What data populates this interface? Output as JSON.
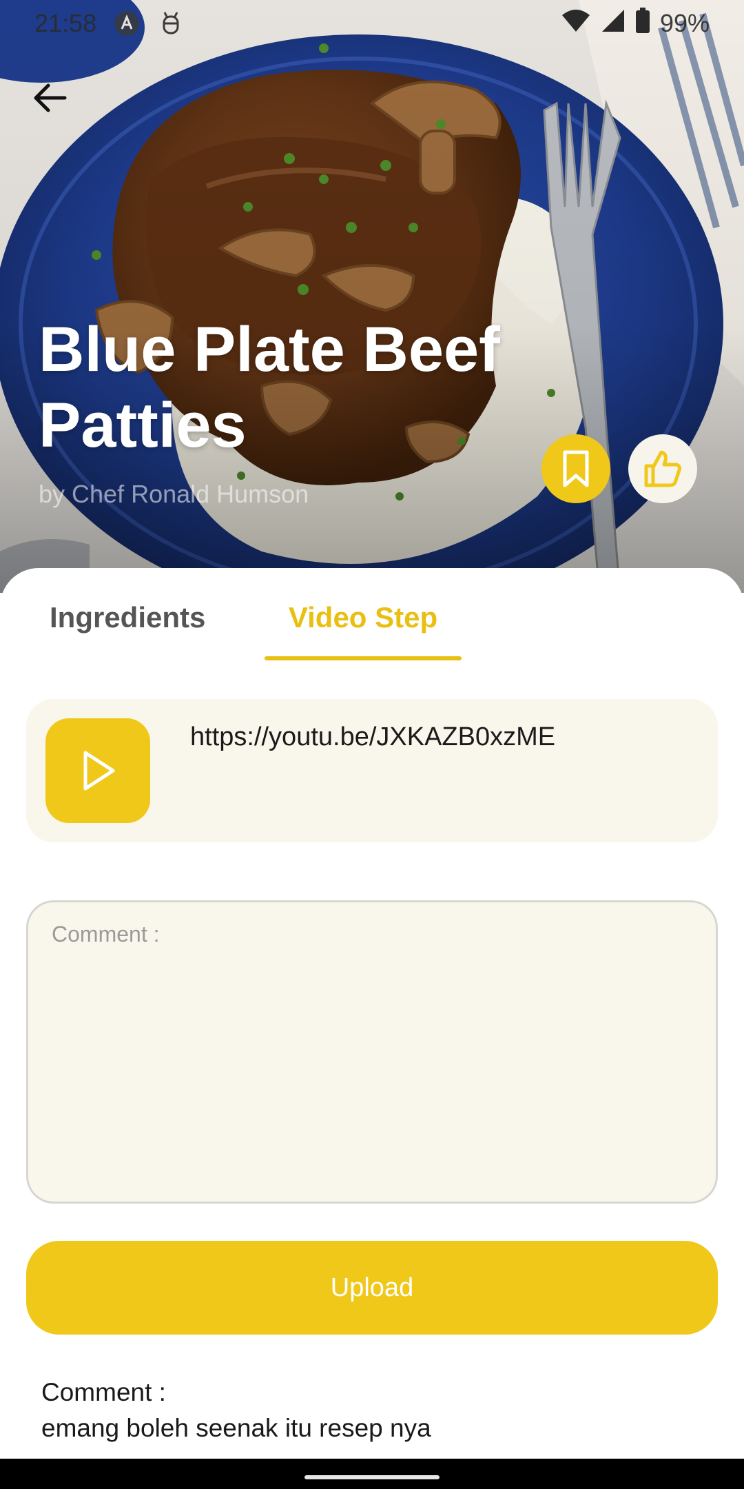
{
  "status_bar": {
    "time": "21:58",
    "battery_percent": "99%",
    "icons": [
      "app-a-icon",
      "bug-icon",
      "wifi-icon",
      "signal-icon",
      "battery-icon"
    ]
  },
  "navigation": {
    "back_icon": "arrow-left-icon"
  },
  "recipe": {
    "title": "Blue Plate Beef Patties",
    "author": "by Chef Ronald Humson",
    "actions": [
      {
        "name": "bookmark",
        "icon": "bookmark-icon",
        "color": "#f0c81a"
      },
      {
        "name": "like",
        "icon": "thumbs-up-icon",
        "color": "#f7f4ec"
      }
    ]
  },
  "tabs": [
    {
      "label": "Ingredients",
      "active": false
    },
    {
      "label": "Video Step",
      "active": true
    }
  ],
  "video": {
    "play_icon": "play-icon",
    "url": "https://youtu.be/JXKAZB0xzME"
  },
  "comment_form": {
    "placeholder": "Comment :",
    "value": "",
    "upload_label": "Upload"
  },
  "comments": {
    "label": "Comment :",
    "items": [
      {
        "text": "emang boleh seenak itu resep nya"
      }
    ]
  },
  "colors": {
    "accent": "#f0c81a",
    "active_tab": "#e9bf12",
    "card_background": "#f9f6ec",
    "plate_blue": "#1d3a8a"
  }
}
